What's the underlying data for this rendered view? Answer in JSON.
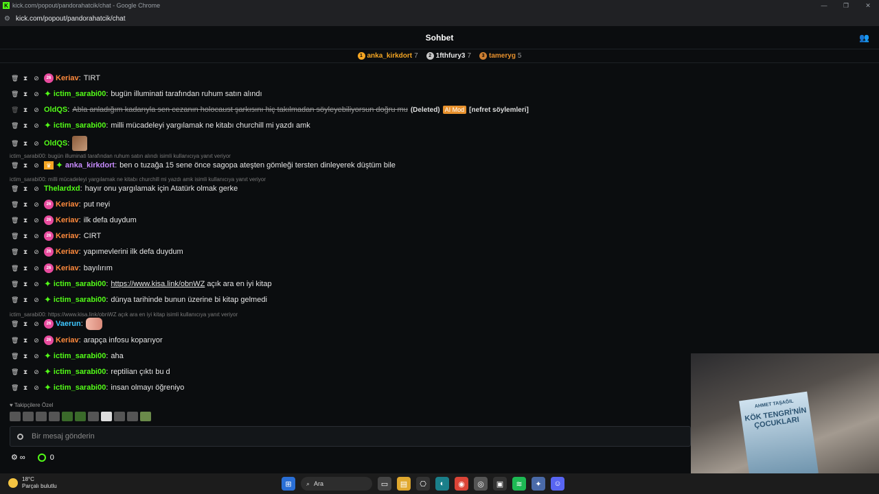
{
  "window": {
    "title": "kick.com/popout/pandorahatcik/chat - Google Chrome",
    "url": "kick.com/popout/pandorahatcik/chat"
  },
  "header": {
    "title": "Sohbet"
  },
  "leaderboard": [
    {
      "rank": "1",
      "name": "anka_kirkdort",
      "count": "7",
      "color": "#f5a623"
    },
    {
      "rank": "2",
      "name": "1fthfury3",
      "count": "7",
      "color": "#c8c8c8"
    },
    {
      "rank": "3",
      "name": "tameryg",
      "count": "5",
      "color": "#cd7f32"
    }
  ],
  "replies": [
    "ictim_sarabi00: bugün illuminati tarafından ruhum satın alındı isimli kullanıcıya yanıt veriyor",
    "ictim_sarabi00: milli mücadeleyi yargılamak ne kitabı churchill mi yazdı amk isimli kullanıcıya yanıt veriyor",
    "ictim_sarabi00: https://www.kisa.link/obnWZ açık ara en iyi kitap isimli kullanıcıya yanıt veriyor"
  ],
  "messages": [
    {
      "user": "Keriav",
      "text": "TIRT"
    },
    {
      "user": "ictim_sarabi00",
      "text": "bugün illuminati tarafından ruhum satın alındı"
    },
    {
      "user": "OldQS",
      "text": "Abla anladığım kadarıyla sen cezanın holocaust şarkısını hiç takılmadan söyleyebiliyorsun doğru mu",
      "deleted": "(Deleted)",
      "ai": "AI Mod",
      "reason": "[nefret söylemleri]"
    },
    {
      "user": "ictim_sarabi00",
      "text": "milli mücadeleyi yargılamak ne kitabı churchill mi yazdı amk"
    },
    {
      "user": "OldQS",
      "text": ""
    },
    {
      "user": "anka_kirkdort",
      "text": "ben o tuzağa 15 sene önce sagopa ateşten gömleği tersten dinleyerek düştüm bile"
    },
    {
      "user": "Thelardxd",
      "text": "hayır onu yargılamak için Atatürk olmak gerke"
    },
    {
      "user": "Keriav",
      "text": "put neyi"
    },
    {
      "user": "Keriav",
      "text": "ilk defa duydum"
    },
    {
      "user": "Keriav",
      "text": "CIRT"
    },
    {
      "user": "Keriav",
      "text": "yapımevlerini ilk defa duydum"
    },
    {
      "user": "Keriav",
      "text": "bayılırım"
    },
    {
      "user": "ictim_sarabi00",
      "link": "https://www.kisa.link/obnWZ",
      "text": "açık ara en iyi kitap"
    },
    {
      "user": "ictim_sarabi00",
      "text": "dünya tarihinde bunun üzerine bi kitap gelmedi"
    },
    {
      "user": "Vaerun",
      "text": ""
    },
    {
      "user": "Keriav",
      "text": "arapça infosu koparıyor"
    },
    {
      "user": "ictim_sarabi00",
      "text": "aha"
    },
    {
      "user": "ictim_sarabi00",
      "text": "reptilian çıktı bu d"
    },
    {
      "user": "ictim_sarabi00",
      "text": "insan olmayı öğreniyo"
    }
  ],
  "sub_badge": "26",
  "followers_label": "Takipçilere Özel",
  "input": {
    "placeholder": "Bir mesaj gönderin"
  },
  "bottom": {
    "infinity": "∞",
    "points": "0"
  },
  "book": {
    "author": "AHMET TAŞAĞIL",
    "title": "KÖK TENGRİ'NİN ÇOCUKLARI"
  },
  "taskbar": {
    "temp": "18°C",
    "weather": "Parçalı bulutlu",
    "search": "Ara"
  },
  "colors": {
    "keriav": "#ff8a3d",
    "ictim": "#53fc18",
    "oldqs": "#53fc18",
    "anka": "#c88cff",
    "thelard": "#53fc18",
    "vaerun": "#3ec6ff"
  }
}
